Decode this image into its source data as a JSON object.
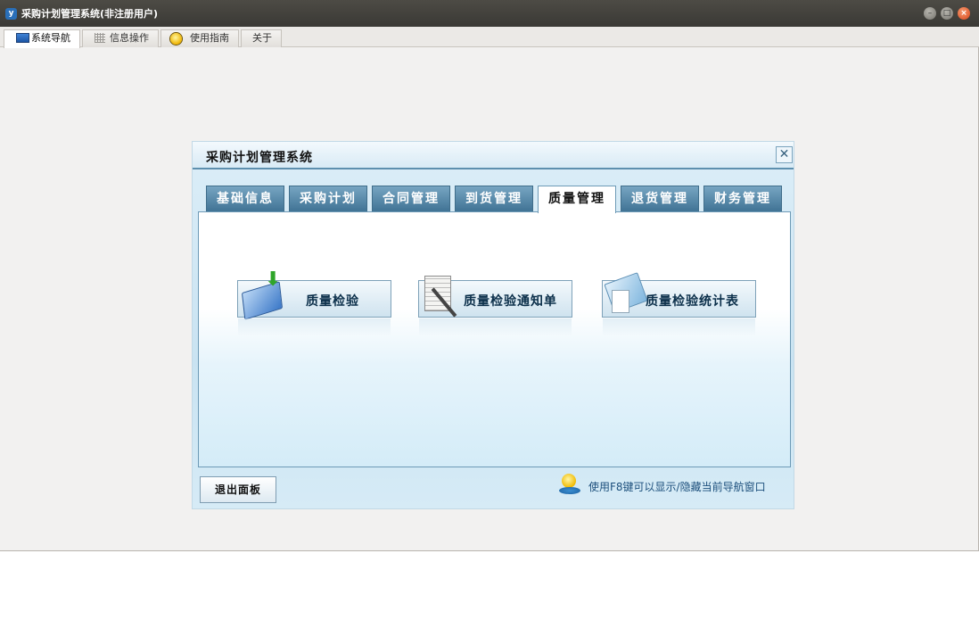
{
  "window": {
    "title": "采购计划管理系统(非注册用户)",
    "app_icon": "y",
    "controls": {
      "minimize": "–",
      "maximize": "□",
      "close": "×"
    }
  },
  "top_tabs": [
    {
      "label": "系统导航",
      "icon": "monitor-icon",
      "active": true
    },
    {
      "label": "信息操作",
      "icon": "grid-icon",
      "active": false
    },
    {
      "label": "使用指南",
      "icon": "bulb-icon",
      "active": false
    },
    {
      "label": "关于",
      "icon": "",
      "active": false
    }
  ],
  "panel": {
    "title": "采购计划管理系统",
    "close_glyph": "✕",
    "nav_tabs": [
      {
        "label": "基础信息",
        "active": false
      },
      {
        "label": "采购计划",
        "active": false
      },
      {
        "label": "合同管理",
        "active": false
      },
      {
        "label": "到货管理",
        "active": false
      },
      {
        "label": "质量管理",
        "active": true
      },
      {
        "label": "退货管理",
        "active": false
      },
      {
        "label": "财务管理",
        "active": false
      }
    ],
    "function_buttons": [
      {
        "label": "质量检验",
        "icon": "inspection-icon"
      },
      {
        "label": "质量检验通知单",
        "icon": "notice-document-icon"
      },
      {
        "label": "质量检验统计表",
        "icon": "statistics-report-icon"
      }
    ],
    "exit_button": "退出面板",
    "hint": "使用F8键可以显示/隐藏当前导航窗口"
  },
  "colors": {
    "titlebar": "#3f3e3a",
    "panel_accent": "#3e7193",
    "panel_bg": "#d6ebf6",
    "window_bg": "#f2f1f0"
  }
}
